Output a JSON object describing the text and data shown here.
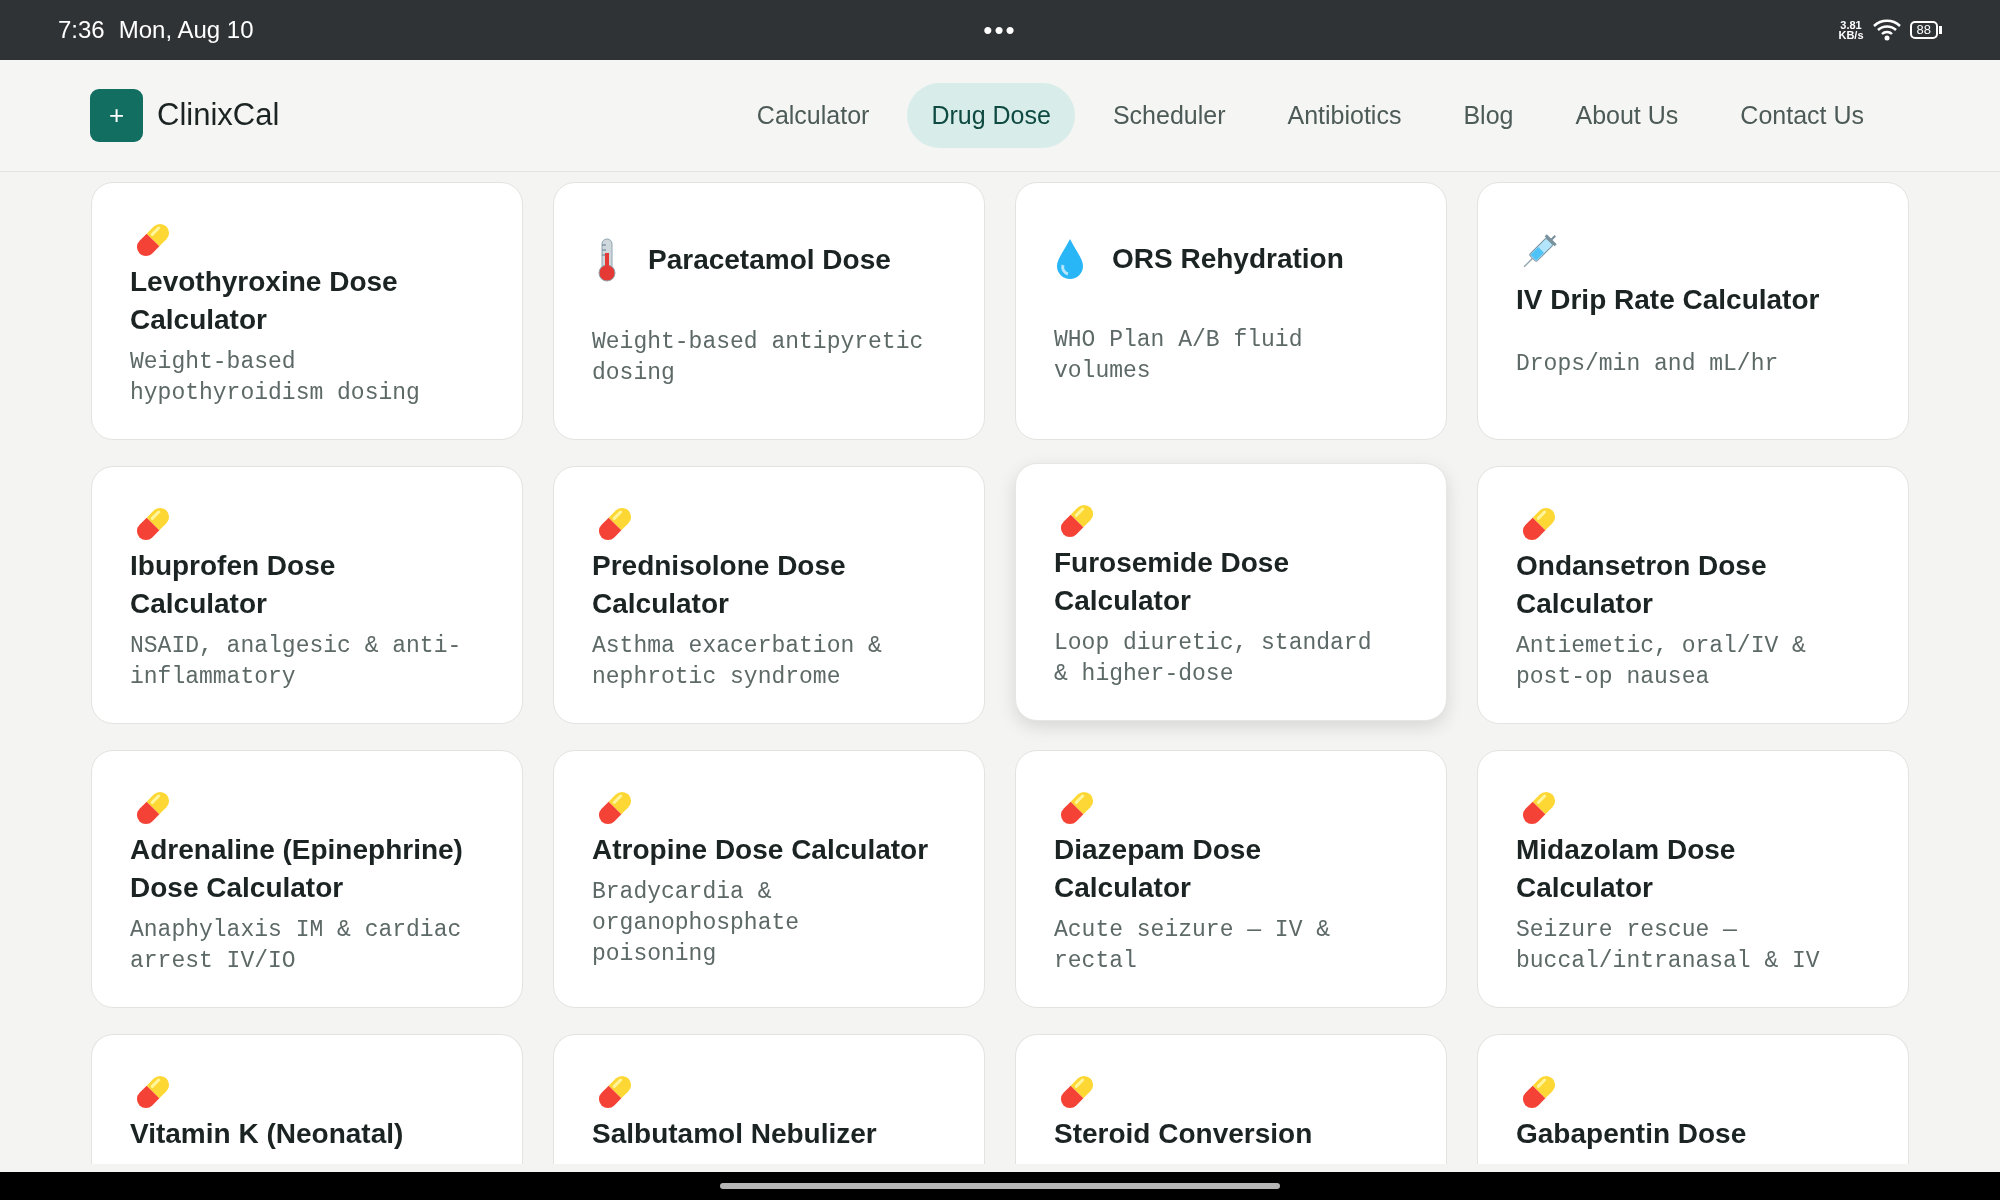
{
  "status_bar": {
    "time": "7:36",
    "date": "Mon, Aug 10",
    "menu": "•••",
    "net_speed": "3.81",
    "net_unit": "KB/s",
    "battery": "88"
  },
  "header": {
    "logo_mark": "+",
    "brand": "ClinixCal",
    "nav": [
      {
        "label": "Calculator",
        "selected": false
      },
      {
        "label": "Drug Dose",
        "selected": true
      },
      {
        "label": "Scheduler",
        "selected": false
      },
      {
        "label": "Antibiotics",
        "selected": false
      },
      {
        "label": "Blog",
        "selected": false
      },
      {
        "label": "About Us",
        "selected": false
      },
      {
        "label": "Contact Us",
        "selected": false
      }
    ]
  },
  "cards": [
    {
      "kind": "pill",
      "title": "Levothyroxine Dose Calculator",
      "description": "Weight-based hypothyroidism dosing",
      "highlighted": false
    },
    {
      "kind": "thermometer",
      "title": "Paracetamol Dose",
      "description": "Weight-based antipyretic dosing",
      "highlighted": false
    },
    {
      "kind": "droplet",
      "title": "ORS Rehydration",
      "description": "WHO Plan A/B fluid volumes",
      "highlighted": false
    },
    {
      "kind": "syringe",
      "title": "IV Drip Rate Calculator",
      "description": "Drops/min and mL/hr",
      "highlighted": false
    },
    {
      "kind": "pill",
      "title": "Ibuprofen Dose Calculator",
      "description": "NSAID, analgesic & anti-inflammatory",
      "highlighted": false
    },
    {
      "kind": "pill",
      "title": "Prednisolone Dose Calculator",
      "description": "Asthma exacerbation & nephrotic syndrome",
      "highlighted": false
    },
    {
      "kind": "pill",
      "title": "Furosemide Dose Calculator",
      "description": "Loop diuretic, standard & higher-dose",
      "highlighted": true
    },
    {
      "kind": "pill",
      "title": "Ondansetron Dose Calculator",
      "description": "Antiemetic, oral/IV & post-op nausea",
      "highlighted": false
    },
    {
      "kind": "pill",
      "title": "Adrenaline (Epinephrine) Dose Calculator",
      "description": "Anaphylaxis IM & cardiac arrest IV/IO",
      "highlighted": false
    },
    {
      "kind": "pill",
      "title": "Atropine Dose Calculator",
      "description": "Bradycardia & organophosphate poisoning",
      "highlighted": false
    },
    {
      "kind": "pill",
      "title": "Diazepam Dose Calculator",
      "description": "Acute seizure — IV & rectal",
      "highlighted": false
    },
    {
      "kind": "pill",
      "title": "Midazolam Dose Calculator",
      "description": "Seizure rescue — buccal/intranasal & IV",
      "highlighted": false
    },
    {
      "kind": "pill",
      "title": "Vitamin K (Neonatal)",
      "highlighted": false
    },
    {
      "kind": "pill",
      "title": "Salbutamol Nebulizer",
      "highlighted": false
    },
    {
      "kind": "pill",
      "title": "Steroid Conversion",
      "highlighted": false
    },
    {
      "kind": "pill",
      "title": "Gabapentin Dose",
      "highlighted": false
    }
  ]
}
